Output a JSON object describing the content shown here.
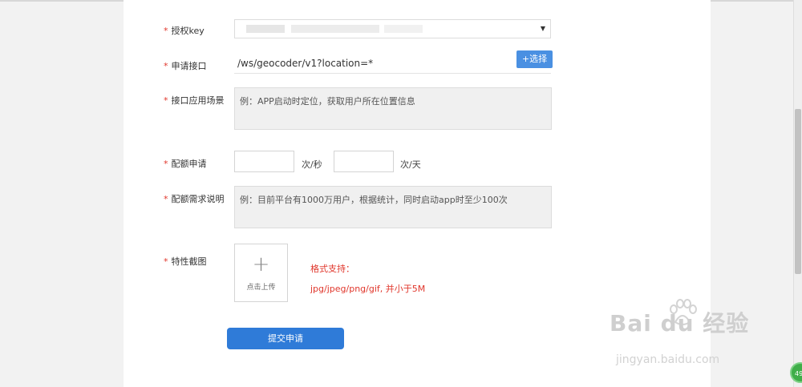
{
  "form": {
    "required_mark": "*",
    "auth_key": {
      "label": "授权key"
    },
    "api": {
      "label": "申请接口",
      "value": "/ws/geocoder/v1?location=*",
      "choose_label": "+选择"
    },
    "scenario": {
      "label": "接口应用场景",
      "placeholder": "例：APP启动时定位，获取用户所在位置信息"
    },
    "quota": {
      "label": "配额申请",
      "unit_per_second": "次/秒",
      "unit_per_day": "次/天"
    },
    "quota_desc": {
      "label": "配额需求说明",
      "placeholder": "例：目前平台有1000万用户，根据统计，同时启动app时至少100次"
    },
    "screenshot": {
      "label": "特性截图",
      "upload_label": "点击上传",
      "format_title": "格式支持：",
      "format_detail": "jpg/jpeg/png/gif, 并小于5M"
    },
    "submit_label": "提交申请"
  },
  "watermark": {
    "logo": "Bai du 经验",
    "url": "jingyan.baidu.com"
  },
  "badge_text": "49",
  "icons": {
    "upload": "plus-icon",
    "select": "caret-down-icon"
  },
  "colors": {
    "accent": "#2f7bd8",
    "required": "#e0362b",
    "choose_button": "#4a90e2"
  }
}
